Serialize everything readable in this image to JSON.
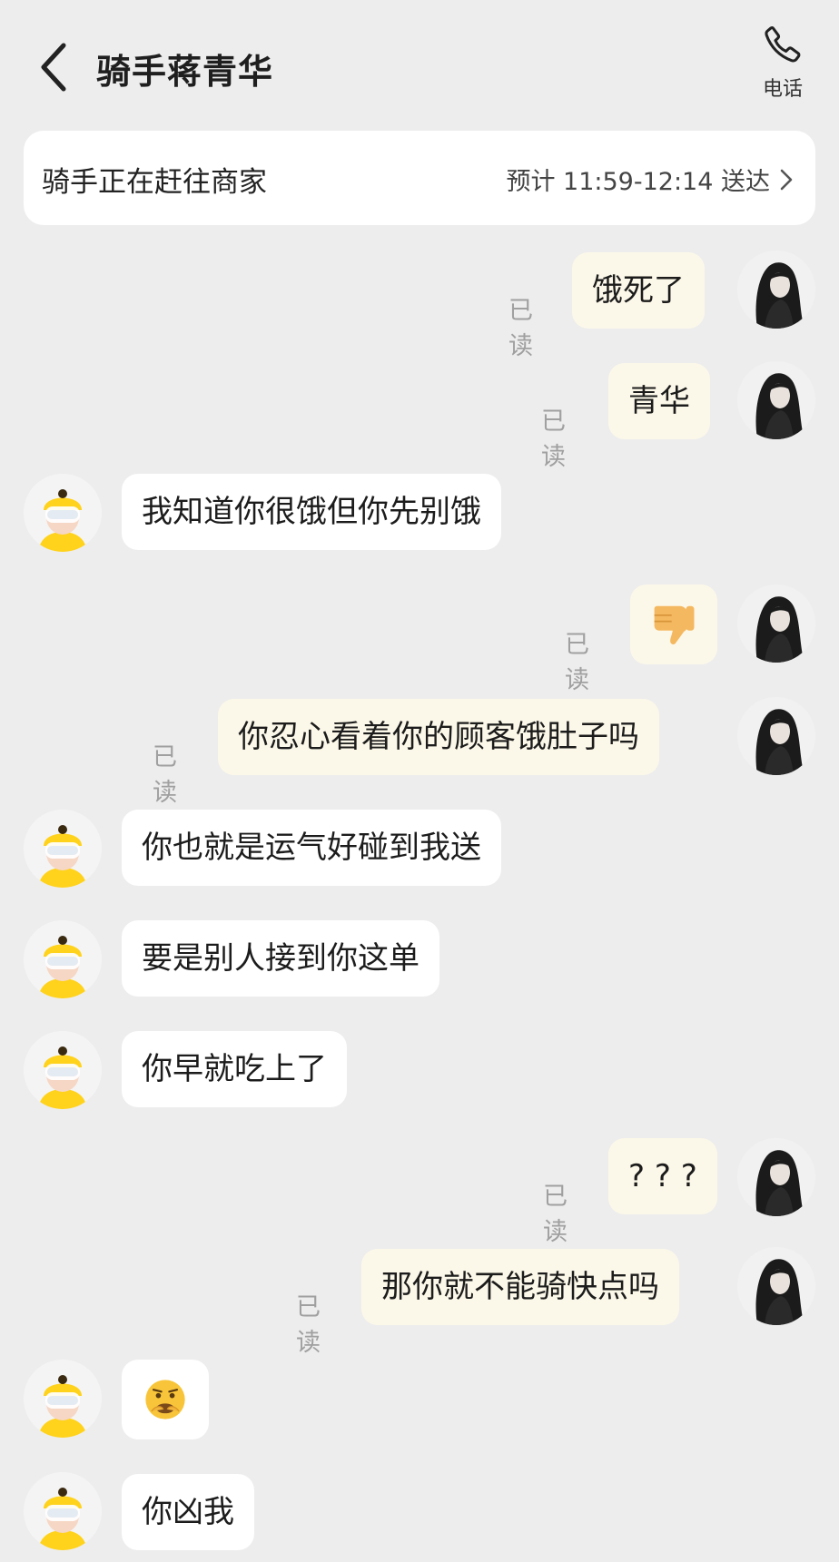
{
  "header": {
    "title": "骑手蒋青华",
    "phone_label": "电话"
  },
  "status": {
    "text": "骑手正在赶往商家",
    "eta": "预计 11:59-12:14 送达"
  },
  "read_label": "已读",
  "messages": [
    {
      "from": "me",
      "text": "饿死了",
      "read": true
    },
    {
      "from": "me",
      "text": "青华",
      "read": true
    },
    {
      "from": "rider",
      "text": "我知道你很饿但你先别饿"
    },
    {
      "from": "me",
      "emoji": "thumbs-down",
      "read": true
    },
    {
      "from": "me",
      "text": "你忍心看着你的顾客饿肚子吗",
      "read": true
    },
    {
      "from": "rider",
      "text": "你也就是运气好碰到我送"
    },
    {
      "from": "rider",
      "text": "要是别人接到你这单"
    },
    {
      "from": "rider",
      "text": "你早就吃上了"
    },
    {
      "from": "me",
      "text": "? ? ?",
      "read": true
    },
    {
      "from": "me",
      "text": "那你就不能骑快点吗",
      "read": true
    },
    {
      "from": "rider",
      "emoji": "anguished-face"
    },
    {
      "from": "rider",
      "text": "你凶我"
    }
  ],
  "colors": {
    "background": "#ededed",
    "my_bubble": "#fcf8e9",
    "rider_bubble": "#ffffff",
    "rider_helmet": "#ffd21c"
  }
}
